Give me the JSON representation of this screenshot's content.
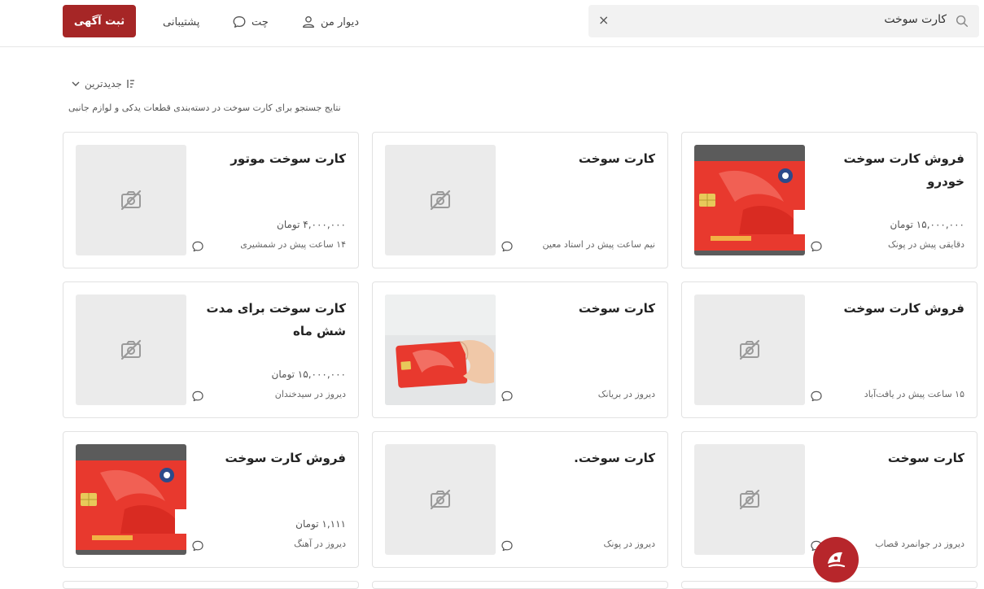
{
  "header": {
    "search_text": "کارت سوخت",
    "clear_glyph": "×",
    "nav": {
      "my_divar": "دیوار من",
      "chat": "چت",
      "support": "پشتیبانی"
    },
    "post_ad": "ثبت آگهی"
  },
  "toolbar": {
    "sort_label": "جدیدترین",
    "result_info": "نتایج جستجو برای کارت سوخت در دسته‌بندی قطعات یدکی و لوازم جانبی"
  },
  "listings": [
    {
      "title": "فروش کارت سوخت خودرو",
      "price": "۱۵,۰۰۰,۰۰۰ تومان",
      "meta": "دقایقی پیش در پونک",
      "image": "fuel-card-photo"
    },
    {
      "title": "کارت سوخت",
      "price": "",
      "meta": "نیم ساعت پیش در استاد معین",
      "image": "placeholder"
    },
    {
      "title": "کارت سوخت موتور",
      "price": "۴,۰۰۰,۰۰۰ تومان",
      "meta": "۱۴ ساعت پیش در شمشیری",
      "image": "placeholder"
    },
    {
      "title": "فروش کارت سوخت",
      "price": "",
      "meta": "۱۵ ساعت پیش در یافت‌آباد",
      "image": "placeholder"
    },
    {
      "title": "کارت سوخت",
      "price": "",
      "meta": "دیروز در بریانک",
      "image": "hand-card-photo"
    },
    {
      "title": "کارت سوخت برای مدت شش ماه",
      "price": "۱۵,۰۰۰,۰۰۰ تومان",
      "meta": "دیروز در سیدخندان",
      "image": "placeholder"
    },
    {
      "title": "کارت سوخت",
      "price": "",
      "meta": "دیروز در جوانمرد قصاب",
      "image": "placeholder"
    },
    {
      "title": "کارت سوخت.",
      "price": "",
      "meta": "دیروز در پونک",
      "image": "placeholder"
    },
    {
      "title": "فروش کارت سوخت",
      "price": "۱,۱۱۱ تومان",
      "meta": "دیروز در آهنگ",
      "image": "fuel-card-photo"
    }
  ],
  "colors": {
    "brand": "#a62626",
    "card_red": "#e8392e"
  },
  "icons": {
    "search": "search-icon",
    "clear": "close-icon",
    "user": "user-icon",
    "chat": "chat-bubble-icon",
    "sort": "sort-icon",
    "chevron": "chevron-down-icon",
    "no_image": "image-off-icon",
    "fab": "logo-icon"
  }
}
